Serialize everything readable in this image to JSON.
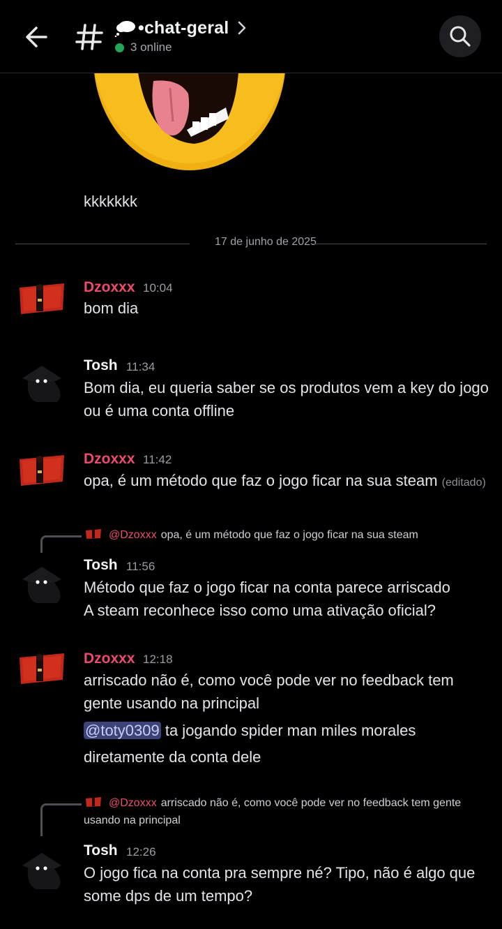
{
  "header": {
    "channel_name": "•chat-geral",
    "online_text": "3 online",
    "accent_online": "#23a55a",
    "icons": [
      "back-arrow-icon",
      "hash-icon",
      "cloud-emoji-icon",
      "chevron-right-icon",
      "search-icon"
    ]
  },
  "pre_messages": {
    "text": "kkkkkkk"
  },
  "date_divider": "17 de junho de 2025",
  "colors": {
    "username_dzoxxx": "#ec4b6d",
    "username_tosh": "#f2f3f5",
    "mention_bg": "#3c4376",
    "background": "#000000"
  },
  "messages": [
    {
      "username": "Dzoxxx",
      "time": "10:04",
      "lines": [
        "bom dia"
      ]
    },
    {
      "username": "Tosh",
      "time": "11:34",
      "lines": [
        "Bom dia, eu queria saber se os produtos vem a key do jogo",
        "ou é uma conta offline"
      ]
    },
    {
      "username": "Dzoxxx",
      "time": "11:42",
      "lines": [
        "opa, é um método que faz o jogo ficar na sua steam"
      ],
      "edited": "(editado)"
    },
    {
      "username": "Tosh",
      "time": "11:56",
      "reply": {
        "user": "@Dzoxxx",
        "text": "opa, é um método que faz o jogo ficar na sua steam"
      },
      "lines": [
        "Método que faz o jogo ficar na conta parece arriscado",
        "A steam reconhece isso como uma ativação oficial?"
      ]
    },
    {
      "username": "Dzoxxx",
      "time": "12:18",
      "lines": [
        "arriscado não é, como você pode ver no feedback tem",
        "gente usando na principal"
      ],
      "mention": "@toty0309",
      "mention_rest": " ta jogando spider man miles morales",
      "last_line": "diretamente da conta dele"
    },
    {
      "username": "Tosh",
      "time": "12:26",
      "reply": {
        "user": "@Dzoxxx",
        "text_line1": "arriscado não é, como você pode ver no feedback tem gente",
        "text_line2": "usando na principal"
      },
      "lines": [
        "O jogo fica na conta pra sempre né? Tipo, não é algo que",
        "some dps de um tempo?"
      ]
    }
  ]
}
